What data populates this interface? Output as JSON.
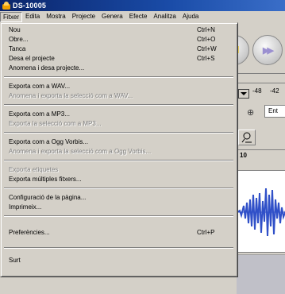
{
  "window": {
    "title": "DS-10005"
  },
  "menubar": {
    "items": [
      "Fitxer",
      "Edita",
      "Mostra",
      "Projecte",
      "Genera",
      "Efecte",
      "Analitza",
      "Ajuda"
    ]
  },
  "file_menu": {
    "nou": {
      "label": "Nou",
      "shortcut": "Ctrl+N"
    },
    "obre": {
      "label": "Obre...",
      "shortcut": "Ctrl+O"
    },
    "tanca": {
      "label": "Tanca",
      "shortcut": "Ctrl+W"
    },
    "desa": {
      "label": "Desa el projecte",
      "shortcut": "Ctrl+S"
    },
    "anomena": {
      "label": "Anomena i desa projecte..."
    },
    "exp_wav": {
      "label": "Exporta com a WAV..."
    },
    "sel_wav": {
      "label": "Anomena i exporta la selecció com a WAV..."
    },
    "exp_mp3": {
      "label": "Exporta com a MP3..."
    },
    "sel_mp3": {
      "label": "Exporta la selecció com a MP3..."
    },
    "exp_ogg": {
      "label": "Exporta com a Ogg Vorbis..."
    },
    "sel_ogg": {
      "label": "Anomena i exporta la selecció com a Ogg Vorbis..."
    },
    "exp_etiq": {
      "label": "Exporta etiquetes"
    },
    "exp_multi": {
      "label": "Exporta múltiples fitxers..."
    },
    "config": {
      "label": "Configuració de la pàgina..."
    },
    "imprimeix": {
      "label": "Imprimeix..."
    },
    "prefs": {
      "label": "Preferències...",
      "shortcut": "Ctrl+P"
    },
    "surt": {
      "label": "Surt"
    }
  },
  "background": {
    "meter_labels": [
      "-48",
      "-42"
    ],
    "input_value": "Ent",
    "ruler_label": "10"
  }
}
